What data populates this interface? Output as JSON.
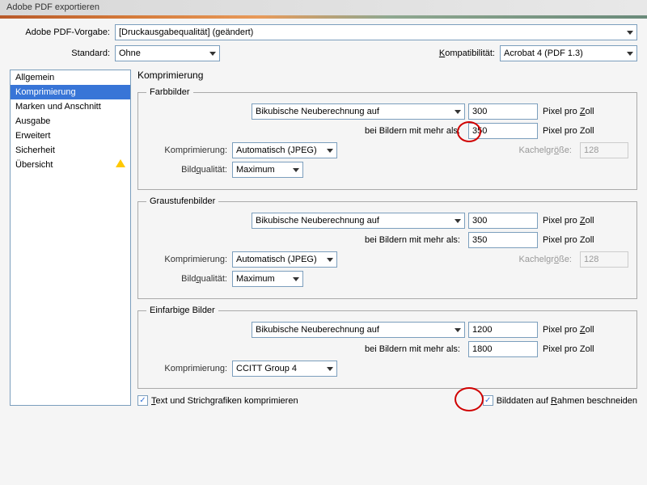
{
  "title": "Adobe PDF exportieren",
  "preset": {
    "label": "Adobe PDF-Vorgabe:",
    "value": "[Druckausgabequalität] (geändert)"
  },
  "standard": {
    "label": "Standard:",
    "value": "Ohne"
  },
  "compat": {
    "label": "Kompatibilität:",
    "value": "Acrobat 4 (PDF 1.3)"
  },
  "sidebar": {
    "items": [
      {
        "label": "Allgemein"
      },
      {
        "label": "Komprimierung"
      },
      {
        "label": "Marken und Anschnitt"
      },
      {
        "label": "Ausgabe"
      },
      {
        "label": "Erweitert"
      },
      {
        "label": "Sicherheit"
      },
      {
        "label": "Übersicht"
      }
    ]
  },
  "panel_title": "Komprimierung",
  "color": {
    "legend": "Farbbilder",
    "downsample": "Bikubische Neuberechnung auf",
    "dpi1": "300",
    "unit1": "Pixel pro Zoll",
    "threshold_label": "bei Bildern mit mehr als:",
    "threshold": "350",
    "unit2": "Pixel pro Zoll",
    "compress_label": "Komprimierung:",
    "compress": "Automatisch (JPEG)",
    "tile_label": "Kachelgröße:",
    "tile": "128",
    "quality_label": "Bildqualität:",
    "quality": "Maximum"
  },
  "gray": {
    "legend": "Graustufenbilder",
    "downsample": "Bikubische Neuberechnung auf",
    "dpi1": "300",
    "unit1": "Pixel pro Zoll",
    "threshold_label": "bei Bildern mit mehr als:",
    "threshold": "350",
    "unit2": "Pixel pro Zoll",
    "compress_label": "Komprimierung:",
    "compress": "Automatisch (JPEG)",
    "tile_label": "Kachelgröße:",
    "tile": "128",
    "quality_label": "Bildqualität:",
    "quality": "Maximum"
  },
  "mono": {
    "legend": "Einfarbige Bilder",
    "downsample": "Bikubische Neuberechnung auf",
    "dpi1": "1200",
    "unit1": "Pixel pro Zoll",
    "threshold_label": "bei Bildern mit mehr als:",
    "threshold": "1800",
    "unit2": "Pixel pro Zoll",
    "compress_label": "Komprimierung:",
    "compress": "CCITT Group 4"
  },
  "compress_text": "Text und Strichgrafiken komprimieren",
  "crop_frames": "Bilddaten auf Rahmen beschneiden"
}
